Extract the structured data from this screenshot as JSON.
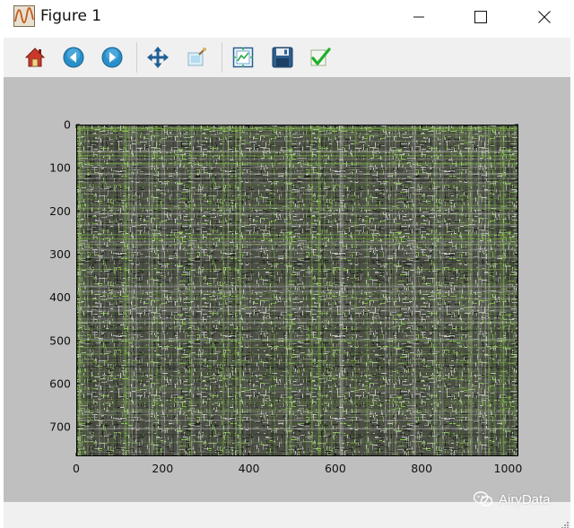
{
  "window": {
    "title": "Figure 1",
    "app_icon": "matplotlib-figure-icon"
  },
  "window_controls": {
    "minimize_icon": "minimize-icon",
    "maximize_icon": "maximize-icon",
    "close_icon": "close-icon"
  },
  "toolbar": {
    "tools": [
      {
        "name": "home-button",
        "icon": "home-icon"
      },
      {
        "name": "back-button",
        "icon": "back-arrow-icon"
      },
      {
        "name": "forward-button",
        "icon": "forward-arrow-icon"
      },
      {
        "name": "pan-button",
        "icon": "pan-move-icon"
      },
      {
        "name": "zoom-button",
        "icon": "zoom-rect-icon"
      },
      {
        "name": "subplots-button",
        "icon": "configure-subplots-icon"
      },
      {
        "name": "save-button",
        "icon": "save-floppy-icon"
      },
      {
        "name": "edit-axis-button",
        "icon": "edit-checkmark-icon"
      }
    ]
  },
  "chart_data": {
    "type": "heatmap",
    "title": "",
    "xlabel": "",
    "ylabel": "",
    "xlim": [
      0,
      1024
    ],
    "ylim": [
      768,
      0
    ],
    "x_ticks": [
      0,
      200,
      400,
      600,
      800,
      1000
    ],
    "y_ticks": [
      0,
      100,
      200,
      300,
      400,
      500,
      600,
      700
    ],
    "grid": false,
    "colors": {
      "dark": "#1e221c",
      "mid": "#6b7060",
      "light": "#c8c8c8",
      "green": "#8ccf4a"
    }
  },
  "watermark": {
    "text": "AiryData"
  }
}
